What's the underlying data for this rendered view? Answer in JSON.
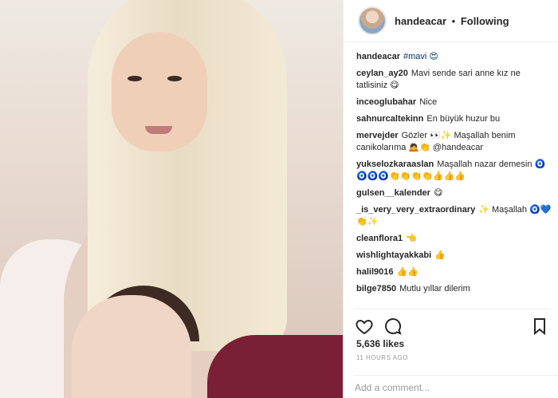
{
  "post": {
    "username": "handeacar",
    "follow_status": "Following",
    "likes": "5,636 likes",
    "time": "11 HOURS AGO",
    "add_comment_placeholder": "Add a comment..."
  },
  "comments": [
    {
      "user": "handeacar",
      "text": "#mavi 😍"
    },
    {
      "user": "ceylan_ay20",
      "text": "Mavi sende sari anne kız ne tatlisiniz 😋"
    },
    {
      "user": "inceoglubahar",
      "text": "Nice"
    },
    {
      "user": "sahnurcaltekinn",
      "text": "En büyük huzur bu"
    },
    {
      "user": "mervejder",
      "text": "Gözler 👀✨ Maşallah benim canikolarıma 🙇👏 @handeacar"
    },
    {
      "user": "yukselozkaraaslan",
      "text": "Maşallah nazar demesin 🧿🧿🧿🧿👏👏👏👏👍👍👍"
    },
    {
      "user": "gulsen__kalender",
      "text": "😋"
    },
    {
      "user": "_is_very_very_extraordinary",
      "text": "✨ Maşallah 🧿💙👏✨"
    },
    {
      "user": "cleanflora1",
      "text": "👈"
    },
    {
      "user": "wishlightayakkabi",
      "text": "👍"
    },
    {
      "user": "halil9016",
      "text": "👍👍"
    },
    {
      "user": "bilge7850",
      "text": "Mutlu yıllar dilerim"
    }
  ]
}
